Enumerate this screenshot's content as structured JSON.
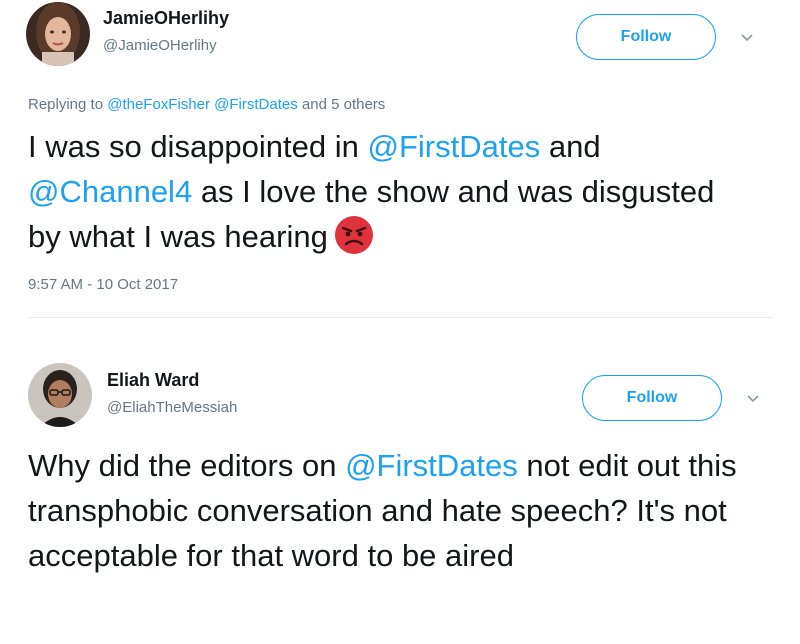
{
  "tweets": [
    {
      "name": "JamieOHerlihy",
      "handle": "@JamieOHerlihy",
      "follow_label": "Follow",
      "reply": {
        "prefix": "Replying to ",
        "mention1": "@theFoxFisher",
        "mention2": "@FirstDates",
        "suffix": " and 5 others"
      },
      "text": {
        "p1": "I was so disappointed in ",
        "m1": "@FirstDates",
        "p2": " and ",
        "m2": "@Channel4",
        "p3": " as I love the show and was disgusted by what I was hearing"
      },
      "emoji": "angry-face-icon",
      "timestamp": "9:57 AM - 10 Oct 2017"
    },
    {
      "name": "Eliah Ward",
      "handle": "@EliahTheMessiah",
      "follow_label": "Follow",
      "text": {
        "p1": "Why did the editors on ",
        "m1": "@FirstDates",
        "p2": " not edit out this transphobic conversation and hate speech? It's not acceptable for that word to be aired"
      }
    }
  ],
  "colors": {
    "accent": "#1da1f2",
    "text": "#14171a",
    "secondary": "#657786",
    "divider": "#e6ecf0",
    "emoji": "#e0323a"
  }
}
